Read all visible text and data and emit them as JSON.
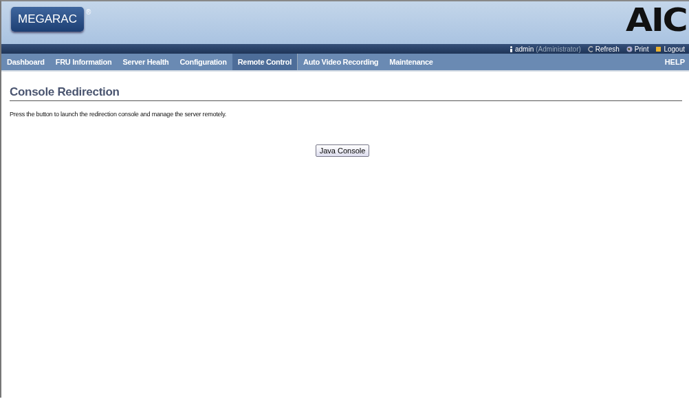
{
  "header": {
    "logo": "MEGARAC",
    "logo_mark": "®",
    "brand": "AIC"
  },
  "user_bar": [
    {
      "kind": "user",
      "label": "admin",
      "role": "(Administrator)"
    },
    {
      "kind": "refresh",
      "label": "Refresh"
    },
    {
      "kind": "print",
      "label": "Print"
    },
    {
      "kind": "logout",
      "label": "Logout"
    }
  ],
  "nav": [
    {
      "label": "Dashboard",
      "selected": false
    },
    {
      "label": "FRU Information",
      "selected": false
    },
    {
      "label": "Server Health",
      "selected": false
    },
    {
      "label": "Configuration",
      "selected": false
    },
    {
      "label": "Remote Control",
      "selected": true
    },
    {
      "label": "Auto Video Recording",
      "selected": false
    },
    {
      "label": "Maintenance",
      "selected": false
    }
  ],
  "help": "HELP",
  "page": {
    "title": "Console Redirection",
    "description": "Press the button to launch the redirection console and manage the server remotely.",
    "button": "Java Console"
  }
}
